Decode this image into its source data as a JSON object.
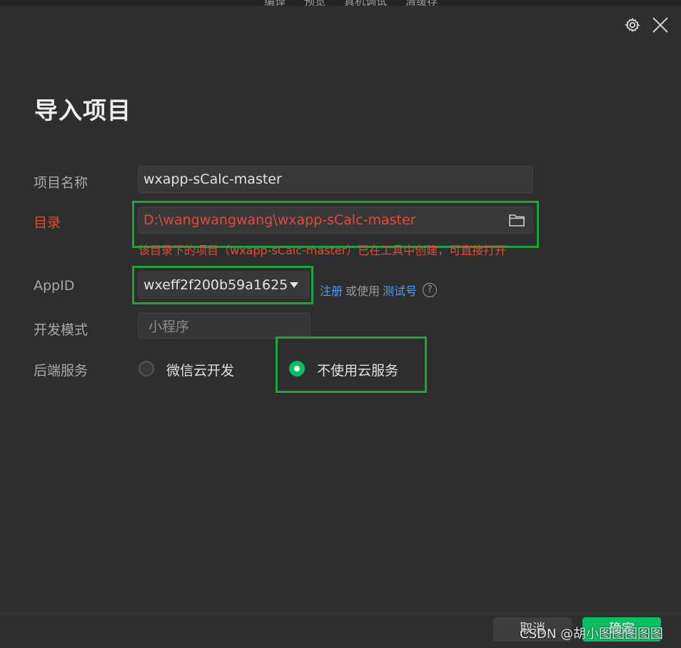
{
  "topbar": {
    "items": [
      "编译",
      "预览",
      "真机调试",
      "清缓存"
    ]
  },
  "dialog": {
    "title": "导入项目",
    "labels": {
      "project_name": "项目名称",
      "directory": "目录",
      "appid": "AppID",
      "dev_mode": "开发模式",
      "backend": "后端服务"
    },
    "project_name_value": "wxapp-sCalc-master",
    "directory_value": "D:\\wangwangwang\\wxapp-sCalc-master",
    "directory_hint": "该目录下的项目（wxapp-sCalc-master）已在工具中创建，可直接打开",
    "appid_value": "wxeff2f200b59a1625",
    "register_link": "注册",
    "or_use_text": "或使用",
    "test_account_link": "测试号",
    "help_glyph": "?",
    "dev_mode_placeholder": "小程序",
    "backend_options": [
      {
        "label": "微信云开发",
        "selected": false
      },
      {
        "label": "不使用云服务",
        "selected": true
      }
    ],
    "cancel_label": "取消",
    "ok_label": "确定"
  },
  "watermark": "CSDN @胡小图图图图图",
  "colors": {
    "accent_green": "#07c160",
    "error_red": "#e5493a",
    "link_blue": "#4a9eff",
    "highlight_box": "#1ba53d"
  },
  "icons": [
    "gear-icon",
    "close-icon",
    "folder-icon",
    "chevron-down-icon",
    "help-icon"
  ]
}
